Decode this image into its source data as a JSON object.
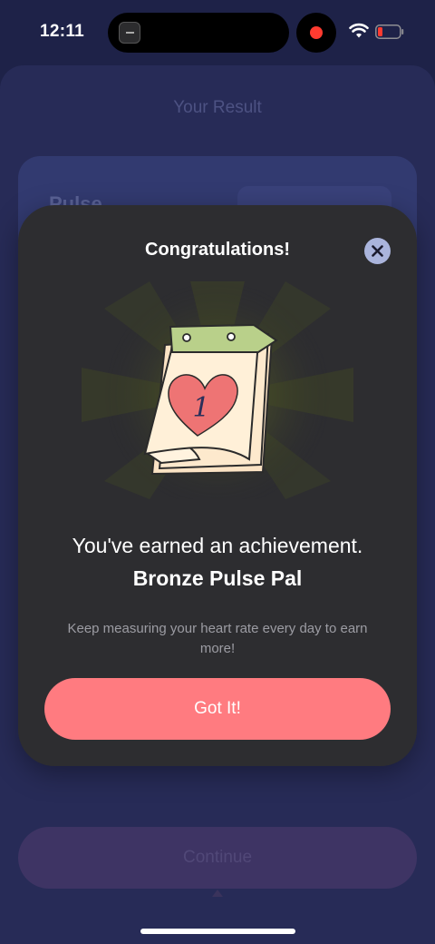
{
  "status_bar": {
    "time": "12:11",
    "recording_color": "#ff3b30",
    "battery_level_color": "#ff3b30"
  },
  "background_screen": {
    "title": "Your Result",
    "card_label": "Pulse",
    "continue_label": "Continue"
  },
  "modal": {
    "title": "Congratulations!",
    "close_icon": "close-icon",
    "illustration": "calendar-heart-icon",
    "calendar_number": "1",
    "earned_text": "You've earned an achievement.",
    "achievement_name": "Bronze Pulse Pal",
    "description": "Keep measuring your heart rate every day to earn more!",
    "button_label": "Got It!",
    "accent_color": "#ff7b80"
  }
}
